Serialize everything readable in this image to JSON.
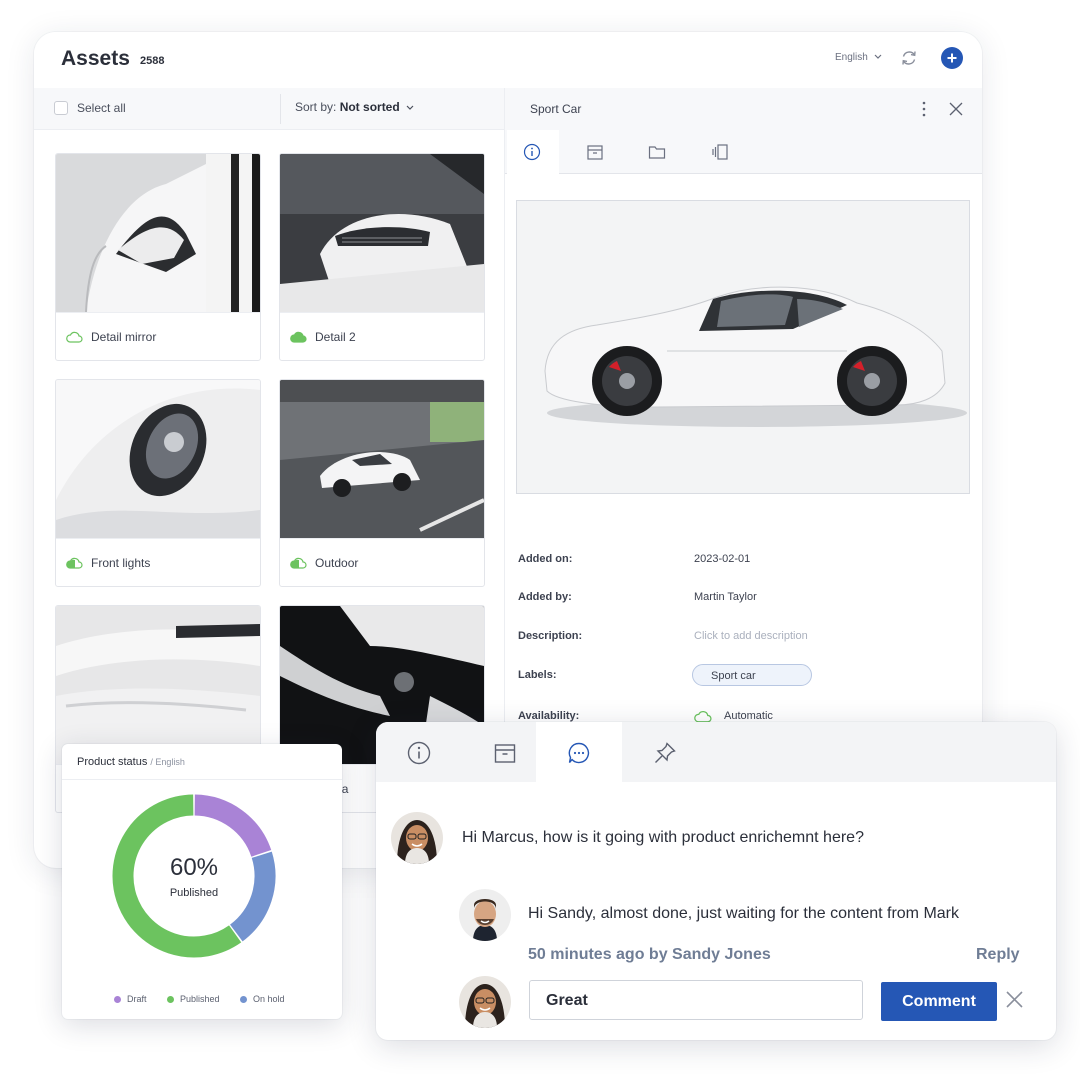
{
  "header": {
    "title": "Assets",
    "count": "2588",
    "language": "English",
    "icons": [
      "refresh-icon",
      "plus-icon"
    ]
  },
  "toolbar": {
    "select_all": "Select all",
    "sort_prefix": "Sort by: ",
    "sort_value": "Not sorted"
  },
  "assets": [
    {
      "label": "Detail mirror",
      "availability_icon": "cloud-outline-icon"
    },
    {
      "label": "Detail 2",
      "availability_icon": "cloud-filled-icon"
    },
    {
      "label": "Front lights",
      "availability_icon": "cloud-partial-icon"
    },
    {
      "label": "Outdoor",
      "availability_icon": "cloud-partial-icon"
    },
    {
      "label": "",
      "availability_icon": ""
    },
    {
      "label": "e deta",
      "availability_icon": ""
    }
  ],
  "detail": {
    "title": "Sport Car",
    "tabs": [
      "info-icon",
      "archive-icon",
      "folder-icon",
      "variants-icon"
    ],
    "fields": {
      "added_on_label": "Added on:",
      "added_on": "2023-02-01",
      "added_by_label": "Added by:",
      "added_by": "Martin Taylor",
      "description_label": "Description:",
      "description_placeholder": "Click to add description",
      "labels_label": "Labels:",
      "label_tag": "Sport car",
      "availability_label": "Availability:",
      "availability": "Automatic"
    }
  },
  "product_status": {
    "title": "Product status",
    "subtitle": "/ English",
    "percent": "60%",
    "percent_label": "Published",
    "legend": [
      "Draft",
      "Published",
      "On hold"
    ],
    "colors": {
      "Draft": "#a983d6",
      "Published": "#6cc35f",
      "On hold": "#7393cf"
    }
  },
  "chart_data": {
    "type": "pie",
    "categories": [
      "Draft",
      "Published",
      "On hold"
    ],
    "values": [
      20,
      60,
      20
    ]
  },
  "comments": {
    "tabs": [
      "info-icon",
      "archive-icon",
      "chat-icon",
      "pin-icon"
    ],
    "messages": [
      {
        "text": "Hi Marcus, how is it going with product enrichemnt here?"
      },
      {
        "text": "Hi Sandy, almost done, just waiting for the content from Mark",
        "meta": "50 minutes ago by Sandy Jones",
        "reply": "Reply"
      }
    ],
    "input_value": "Great",
    "submit_label": "Comment"
  },
  "colors": {
    "accent": "#2557b5",
    "cloud_green": "#6cc35f"
  }
}
